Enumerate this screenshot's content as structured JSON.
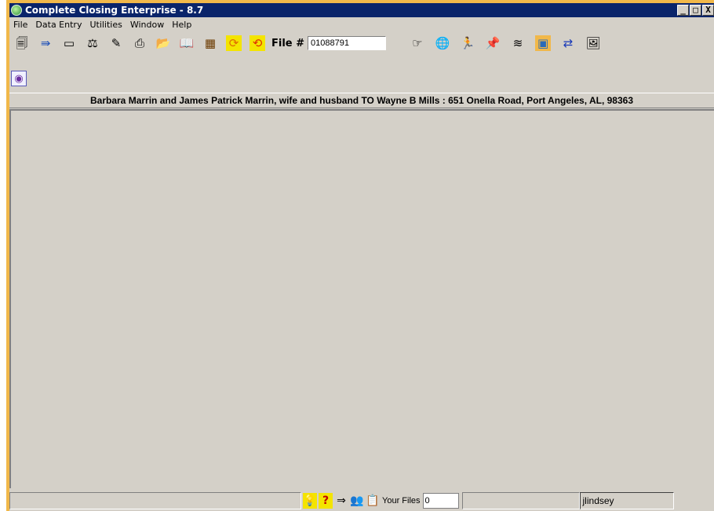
{
  "window": {
    "title": "Complete Closing Enterprise - 8.7",
    "controls": {
      "minimize": "_",
      "maximize": "□",
      "close": "X"
    }
  },
  "menu": {
    "items": [
      "File",
      "Data Entry",
      "Utilities",
      "Window",
      "Help"
    ]
  },
  "toolbar": {
    "left_icons": [
      {
        "name": "form-icon",
        "glyph": "🗐"
      },
      {
        "name": "forward-icon",
        "glyph": "⇛"
      },
      {
        "name": "pdf-icon",
        "glyph": "▭"
      },
      {
        "name": "alta-icon",
        "glyph": "⚖"
      },
      {
        "name": "stamp-icon",
        "glyph": "✎"
      },
      {
        "name": "print-icon",
        "glyph": "⎙"
      },
      {
        "name": "folder-open-icon",
        "glyph": "📂"
      },
      {
        "name": "book-icon",
        "glyph": "📖"
      },
      {
        "name": "chart-icon",
        "glyph": "▦"
      },
      {
        "name": "refresh-icon",
        "glyph": "⟳"
      },
      {
        "name": "sync-icon",
        "glyph": "⟲"
      }
    ],
    "file_label": "File #",
    "file_number": "01088791",
    "right_icons": [
      {
        "name": "hand-pointer-icon",
        "glyph": "☞"
      },
      {
        "name": "globe-icon",
        "glyph": "🌐"
      },
      {
        "name": "runner-icon",
        "glyph": "🏃"
      },
      {
        "name": "pin-icon",
        "glyph": "📌"
      },
      {
        "name": "wave-icon",
        "glyph": "≋"
      },
      {
        "name": "monitor-icon",
        "glyph": "▣"
      },
      {
        "name": "transfer-icon",
        "glyph": "⇄"
      },
      {
        "name": "picture-icon",
        "glyph": "🖼"
      }
    ]
  },
  "toolbar2": {
    "icon": {
      "name": "document-search-icon",
      "glyph": "◉"
    }
  },
  "banner": {
    "text": "Barbara Marrin and James Patrick Marrin, wife and husband TO Wayne B Mills : 651 Onella Road, Port Angeles, AL, 98363"
  },
  "statusbar": {
    "icons": [
      {
        "name": "lightbulb-icon",
        "glyph": "💡"
      },
      {
        "name": "help-icon",
        "glyph": "?"
      },
      {
        "name": "arrow-doc-icon",
        "glyph": "⇒"
      },
      {
        "name": "people-icon",
        "glyph": "👥"
      },
      {
        "name": "clipboard-icon",
        "glyph": "📋"
      }
    ],
    "your_files_label": "Your Files",
    "your_files_value": "0",
    "username": "jlindsey"
  },
  "colors": {
    "titlebar": "#0a246a",
    "frame_accent": "#f1b84a",
    "chrome": "#d4d0c8"
  }
}
